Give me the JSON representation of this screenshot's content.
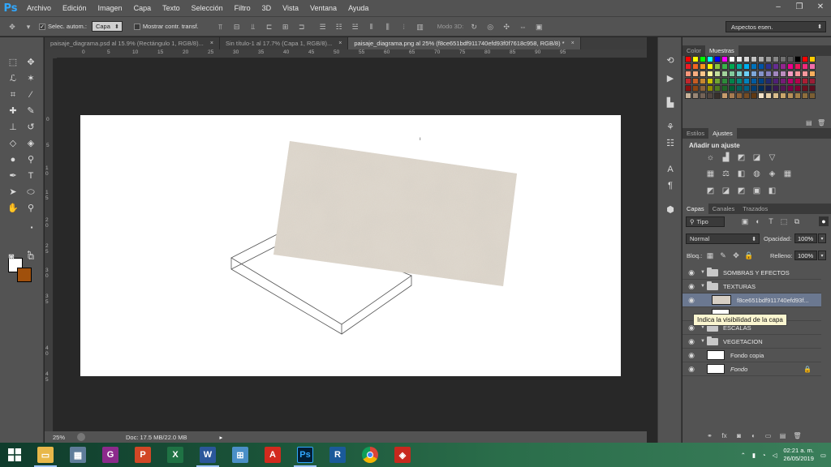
{
  "app": {
    "logo": "Ps"
  },
  "menu": [
    "Archivo",
    "Edición",
    "Imagen",
    "Capa",
    "Texto",
    "Selección",
    "Filtro",
    "3D",
    "Vista",
    "Ventana",
    "Ayuda"
  ],
  "window_controls": {
    "minimize": "–",
    "restore": "❐",
    "close": "✕"
  },
  "options": {
    "auto_select_label": "Selec. autom.:",
    "auto_select_value": "Capa",
    "transform_label": "Mostrar contr. transf.",
    "mode3d_label": "Modo 3D:",
    "workspace": "Aspectos esen."
  },
  "tabs": [
    {
      "label": "paisaje_diagrama.psd al 15.9% (Rectángulo 1, RGB/8)...",
      "active": false
    },
    {
      "label": "Sin título-1 al 17.7% (Capa 1, RGB/8)...",
      "active": false
    },
    {
      "label": "paisaje_diagrama.png al 25% (f8ce651bdf911740efd93f0f7618c958, RGB/8) *",
      "active": true
    }
  ],
  "tab_close": "×",
  "ruler_top": [
    "0",
    "5",
    "10",
    "15",
    "20",
    "25",
    "30",
    "35",
    "40",
    "45",
    "50",
    "55",
    "60",
    "65",
    "70",
    "75",
    "80",
    "85",
    "90",
    "95"
  ],
  "ruler_left": [
    "0",
    "5",
    "1 0",
    "1 5",
    "2 0",
    "2 5",
    "3 0",
    "3 5",
    "4 0",
    "4 5"
  ],
  "status": {
    "zoom": "25%",
    "doc": "Doc: 17.5 MB/22.0 MB"
  },
  "panels": {
    "color_tabs": [
      "Color",
      "Muestras"
    ],
    "adjust_tabs": [
      "Estilos",
      "Ajustes"
    ],
    "adjust_title": "Añadir un ajuste",
    "layers_tabs": [
      "Capas",
      "Canales",
      "Trazados"
    ],
    "filter_label": "Tipo",
    "blend_mode": "Normal",
    "opacity_label": "Opacidad:",
    "opacity_value": "100%",
    "lock_label": "Bloq.:",
    "fill_label": "Relleno:",
    "fill_value": "100%"
  },
  "layers": [
    {
      "name": "SOMBRAS Y EFECTOS",
      "type": "group",
      "expanded": true
    },
    {
      "name": "TEXTURAS",
      "type": "group",
      "expanded": true
    },
    {
      "name": "f8ce651bdf911740efd93f...",
      "type": "texture",
      "selected": true
    },
    {
      "name": "",
      "type": "layer"
    },
    {
      "name": "ESCALAS",
      "type": "group",
      "expanded": true
    },
    {
      "name": "VEGETACION",
      "type": "group",
      "expanded": true
    },
    {
      "name": "Fondo copia",
      "type": "layer"
    },
    {
      "name": "Fondo",
      "type": "background",
      "italic": true,
      "locked": true
    }
  ],
  "tooltip": "Indica la visibilidad de la capa",
  "swatch_colors": [
    "#ff0000",
    "#ffff00",
    "#00ff00",
    "#00ffff",
    "#0000ff",
    "#ff00ff",
    "#ffffff",
    "#ebebeb",
    "#d6d6d6",
    "#c2c2c2",
    "#adadad",
    "#999999",
    "#858585",
    "#707070",
    "#5c5c5c",
    "#000000",
    "#ff0000",
    "#ffcc00",
    "#ed1c24",
    "#f26522",
    "#f7941d",
    "#fff200",
    "#8dc63f",
    "#39b54a",
    "#00a651",
    "#00a99d",
    "#00aeef",
    "#0072bc",
    "#0054a6",
    "#2e3192",
    "#662d91",
    "#92278f",
    "#ec008c",
    "#ed145b",
    "#ee2a7b",
    "#f06eaa",
    "#f7977a",
    "#f9ad81",
    "#fdc68a",
    "#fff79a",
    "#c4df9b",
    "#a3d39c",
    "#82ca9d",
    "#7bcdc8",
    "#6ecff6",
    "#7ea7d8",
    "#8493ca",
    "#8882be",
    "#a187be",
    "#bc8dbf",
    "#f49ac2",
    "#f6989d",
    "#f5989d",
    "#fbaf5d",
    "#c1272d",
    "#c65d24",
    "#c7882f",
    "#c9c300",
    "#71a532",
    "#2d8b3a",
    "#00824a",
    "#00857b",
    "#0083be",
    "#005ba1",
    "#004283",
    "#222a6f",
    "#4f2176",
    "#751c75",
    "#b50069",
    "#b4004c",
    "#ab1f34",
    "#9a1e36",
    "#8a1111",
    "#8b4513",
    "#8c6239",
    "#8f8a00",
    "#4f7a21",
    "#1f6627",
    "#005e34",
    "#00625b",
    "#006086",
    "#003d73",
    "#002d5b",
    "#171d4f",
    "#371854",
    "#531654",
    "#7a0049",
    "#7d0034",
    "#6b0f1f",
    "#5a0e20",
    "#c7b299",
    "#998675",
    "#736357",
    "#534741",
    "#372f2a",
    "#c69c6d",
    "#a67c52",
    "#8c6239",
    "#754c24",
    "#603913",
    "#f2e1c7",
    "#e6cfa8",
    "#d9bd8c",
    "#c9a66b",
    "#b7915a",
    "#a38049",
    "#8f6f3d",
    "#7b5e33"
  ],
  "taskbar": {
    "apps": [
      "explorer",
      "calculator",
      "pdf",
      "powerpoint",
      "excel",
      "word",
      "network",
      "acrobat",
      "photoshop",
      "revit",
      "chrome",
      "sketchup"
    ],
    "time": "02:21 a. m.",
    "date": "26/05/2019"
  }
}
